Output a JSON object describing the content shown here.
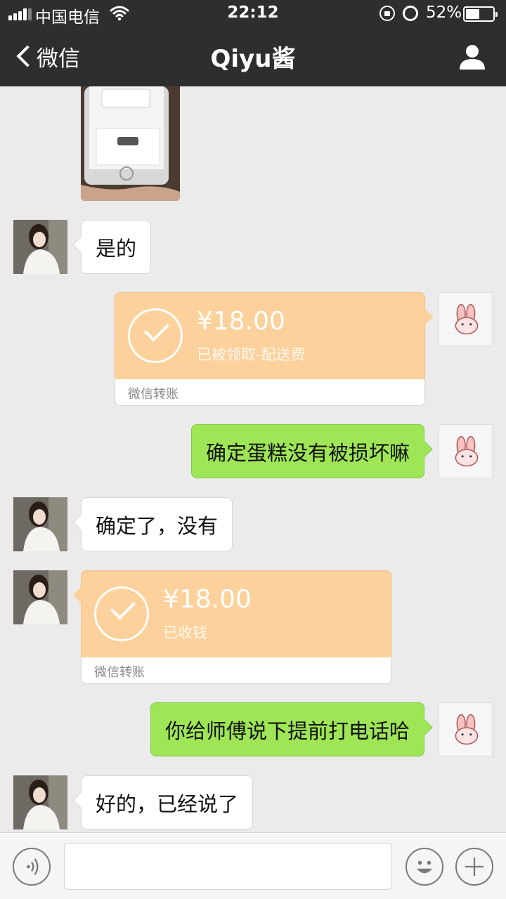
{
  "status_bar": {
    "carrier": "中国电信",
    "time": "22:12",
    "battery_percent": "52%",
    "battery_level": 0.52,
    "icons": [
      "signal-icon",
      "wifi-icon",
      "rotation-lock-icon",
      "alarm-icon",
      "battery-icon"
    ]
  },
  "nav": {
    "back_label": "微信",
    "title": "Qiyu酱",
    "profile_icon": "person-icon"
  },
  "messages": [
    {
      "sender": "them",
      "type": "text",
      "text": "是的"
    },
    {
      "sender": "me",
      "type": "transfer",
      "amount": "¥18.00",
      "note": "已被领取-配送费",
      "footer": "微信转账"
    },
    {
      "sender": "me",
      "type": "text",
      "text": "确定蛋糕没有被损坏嘛"
    },
    {
      "sender": "them",
      "type": "text",
      "text": "确定了，没有"
    },
    {
      "sender": "them",
      "type": "transfer",
      "amount": "¥18.00",
      "note": "已收钱",
      "footer": "微信转账"
    },
    {
      "sender": "me",
      "type": "text",
      "text": "你给师傅说下提前打电话哈"
    },
    {
      "sender": "them",
      "type": "text",
      "text": "好的，已经说了"
    }
  ],
  "input_bar": {
    "voice_icon": "voice-icon",
    "placeholder": "",
    "emoji_icon": "emoji-icon",
    "plus_icon": "plus-icon"
  },
  "colors": {
    "nav_bg": "#2e2e2e",
    "chat_bg": "#ebebeb",
    "my_bubble": "#9ee656",
    "their_bubble": "#ffffff",
    "transfer": "#fdd19b"
  }
}
